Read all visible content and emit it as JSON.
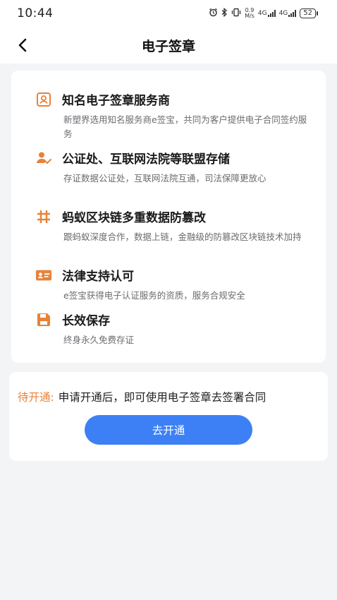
{
  "status_bar": {
    "time": "10:44",
    "net_speed_value": "0.9",
    "net_speed_unit": "M/s",
    "signal1": "4G",
    "signal2": "4G",
    "battery": "52"
  },
  "nav": {
    "title": "电子签章"
  },
  "features": [
    {
      "icon": "certificate-icon",
      "title": "知名电子签章服务商",
      "desc": "新塑界选用知名服务商e签宝，共同为客户提供电子合同签约服务"
    },
    {
      "icon": "user-check-icon",
      "title": "公证处、互联网法院等联盟存储",
      "desc": "存证数据公证处，互联网法院互通，司法保障更放心"
    },
    {
      "icon": "hash-grid-icon",
      "title": "蚂蚁区块链多重数据防篡改",
      "desc": "跟蚂蚁深度合作，数据上链，金融级的防篡改区块链技术加持"
    },
    {
      "icon": "id-card-icon",
      "title": "法律支持认可",
      "desc": "e签宝获得电子认证服务的资质，服务合规安全"
    },
    {
      "icon": "save-icon",
      "title": "长效保存",
      "desc": "终身永久免费存证"
    }
  ],
  "activation": {
    "status_label": "待开通:",
    "status_text": "申请开通后，即可使用电子签章去签署合同",
    "button_label": "去开通"
  },
  "colors": {
    "accent_orange": "#e8823a",
    "primary_blue": "#3d80f5",
    "page_bg": "#f3f4f6"
  }
}
